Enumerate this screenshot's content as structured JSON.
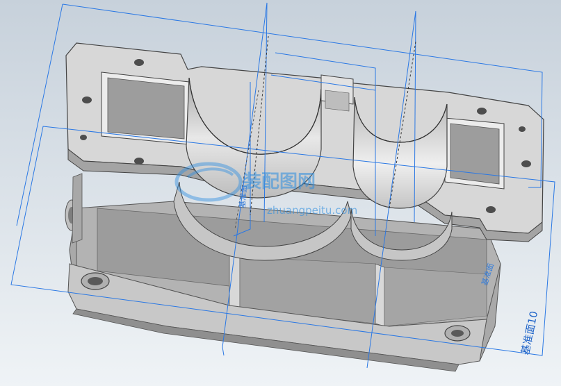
{
  "scene": {
    "background_top": "#c9d3dc",
    "background_bottom": "#eef2f5",
    "part_light": "#d9d9d9",
    "part_mid": "#bdbdbd",
    "part_dark": "#8e8e8e",
    "plane_color": "#2a78e4"
  },
  "labels": {
    "plane_10": "基准面10",
    "plane_side": "基准面",
    "plane_mid": "基准面"
  },
  "watermark": {
    "text_cn": "装配图网",
    "url": "zhuangpeitu.com"
  }
}
